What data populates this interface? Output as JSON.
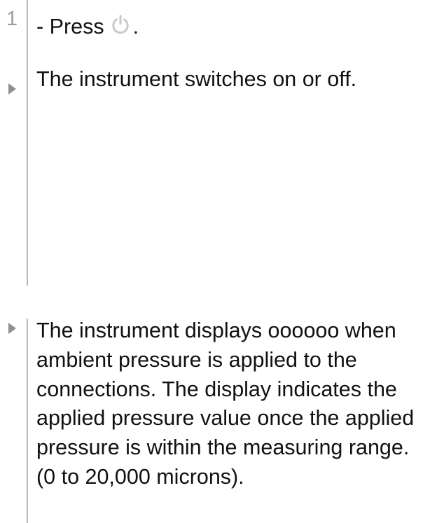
{
  "step": {
    "number": "1",
    "press_label": "- Press",
    "period": ".",
    "icon": "power-icon"
  },
  "results": [
    "The instrument switches on or off.",
    "The instrument displays oooooo when ambient pressure is applied to the connections. The display indicates the applied pressure value once the applied pressure is within the measuring range. (0 to 20,000 microns)."
  ],
  "colors": {
    "text": "#111111",
    "marker": "#8f8f8f",
    "rule": "#b9b9b9",
    "icon": "#c7c9cc"
  }
}
